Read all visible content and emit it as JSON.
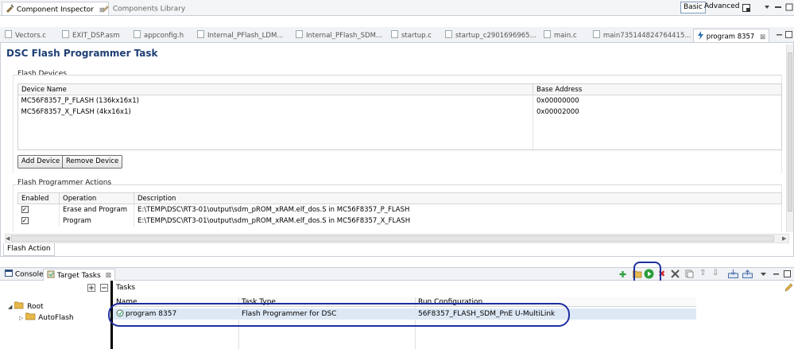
{
  "top_tabs": {
    "component_inspector": "Component Inspector",
    "components_library": "Components Library",
    "close_glyph": "⊠",
    "basic": "Basic",
    "advanced": "Advanced"
  },
  "editor_tabs": [
    {
      "label": "Vectors.c"
    },
    {
      "label": "EXIT_DSP.asm"
    },
    {
      "label": "appconfig.h"
    },
    {
      "label": "Internal_PFlash_LDM..."
    },
    {
      "label": "Internal_PFlash_SDM..."
    },
    {
      "label": "startup.c"
    },
    {
      "label": "startup_c2901696965..."
    },
    {
      "label": "main.c"
    },
    {
      "label": "main735144824764415..."
    },
    {
      "label": "program 8357"
    }
  ],
  "page": {
    "title": "DSC Flash Programmer Task",
    "flash_devices_label": "Flash Devices",
    "devices_headers": [
      "Device Name",
      "Base Address"
    ],
    "devices": [
      {
        "name": "MC56F8357_P_FLASH (136kx16x1)",
        "address": "0x00000000"
      },
      {
        "name": "MC56F8357_X_FLASH (4kx16x1)",
        "address": "0x00002000"
      }
    ],
    "add_device": "Add Device",
    "remove_device": "Remove Device",
    "actions_label": "Flash Programmer Actions",
    "actions_headers": [
      "Enabled",
      "Operation",
      "Description"
    ],
    "actions": [
      {
        "enabled": "✓",
        "operation": "Erase and Program",
        "description": "E:\\TEMP\\DSC\\RT3-01\\output\\sdm_pROM_xRAM.elf_dos.S in MC56F8357_P_FLASH"
      },
      {
        "enabled": "✓",
        "operation": "Program",
        "description": "E:\\TEMP\\DSC\\RT3-01\\output\\sdm_pROM_xRAM.elf_dos.S in MC56F8357_X_FLASH"
      }
    ],
    "flash_action_tab": "Flash Action"
  },
  "bottom": {
    "console_tab": "Console",
    "target_tasks_tab": "Target Tasks",
    "tasks_label": "Tasks",
    "tree": {
      "root": "Root",
      "child": "AutoFlash"
    },
    "columns": [
      "Name",
      "Task Type",
      "Run Configuration"
    ],
    "row": {
      "name": "program 8357",
      "type": "Flash Programmer for DSC",
      "config": "56F8357_FLASH_SDM_PnE U-MultiLink"
    }
  },
  "colors": {
    "title": "#1e3f73",
    "annotation": "#1f2ea0",
    "run_green": "#2a9d3a",
    "folder": "#e8b84a",
    "delete_red": "#d02020"
  }
}
